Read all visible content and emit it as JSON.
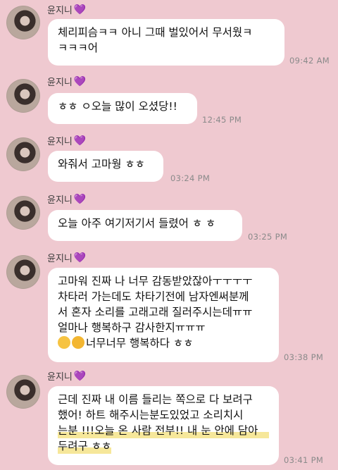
{
  "sender": {
    "name": "윤지니",
    "heart": "💜"
  },
  "messages": [
    {
      "lines": [
        "체리피슴ㅋㅋ 아니 그때 벌있어서 무서웠ㅋ",
        "ㅋㅋㅋ어"
      ],
      "time": "09:42 AM"
    },
    {
      "lines": [
        "ㅎㅎ ㅇ오늘 많이 오셨당!!"
      ],
      "time": "12:45 PM"
    },
    {
      "lines": [
        "와줘서 고마웡 ㅎㅎ"
      ],
      "time": "03:24 PM"
    },
    {
      "lines": [
        "오늘 아주 여기저기서 들렸어 ㅎ ㅎ"
      ],
      "time": "03:25 PM"
    },
    {
      "lines": [
        "고마워 진짜 나 너무 감동받았잖아ㅜㅜㅜㅜ",
        "차타러 가는데도 차타기전에 남자엔써분께",
        "서 혼자 소리를 고래고래 질러주시는데ㅠㅠ",
        "얼마나 행복하구 감사한지ㅠㅠㅠ",
        "너무너무 행복하다 ㅎㅎ"
      ],
      "time": "03:38 PM"
    },
    {
      "lines": [
        "근데 진짜 내 이름 들리는 쪽으로 다 보려구",
        "했어! 하트 해주시는분도있었고 소리치시",
        "는분 !!!오늘 온 사람 전부!! 내 눈 안에 담아",
        "두려구 ㅎㅎ"
      ],
      "time": "03:41 PM"
    }
  ],
  "icons": {
    "avatar": "profile-photo",
    "emoji1": "kissing-face-emoji",
    "emoji2": "heart-eyes-emoji"
  }
}
